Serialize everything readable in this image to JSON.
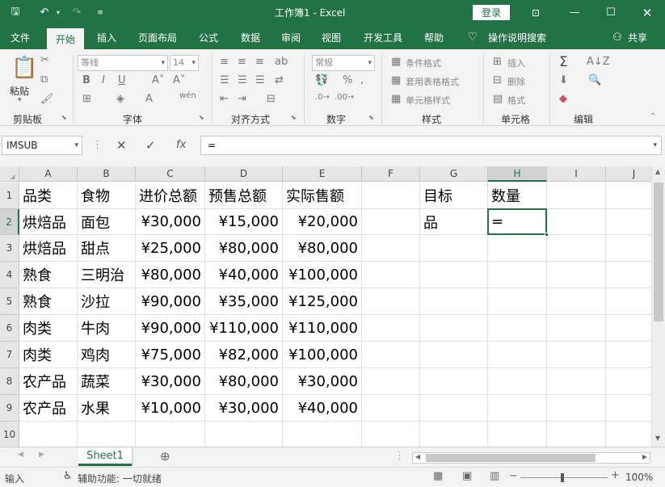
{
  "app": {
    "title": "工作簿1  -  Excel",
    "login_label": "登录"
  },
  "tabs": [
    "文件",
    "开始",
    "插入",
    "页面布局",
    "公式",
    "数据",
    "审阅",
    "视图",
    "开发工具",
    "帮助"
  ],
  "tell_me": "操作说明搜索",
  "share_label": "共享",
  "ribbon": {
    "paste_label": "粘贴",
    "font_name": "等线",
    "font_size": "14",
    "number_format": "常规",
    "conditional_format": "条件格式",
    "table_format": "套用表格格式",
    "cell_style": "单元格样式",
    "insert": "插入",
    "delete": "删除",
    "format": "格式",
    "groups": {
      "clipboard": "剪贴板",
      "font": "字体",
      "alignment": "对齐方式",
      "number": "数字",
      "styles": "样式",
      "cells": "单元格",
      "editing": "编辑"
    }
  },
  "formula_bar": {
    "name_box": "IMSUB",
    "formula": "="
  },
  "columns": [
    "A",
    "B",
    "C",
    "D",
    "E",
    "F",
    "G",
    "H",
    "I",
    "J"
  ],
  "rows": [
    "1",
    "2",
    "3",
    "4",
    "5",
    "6",
    "7",
    "8",
    "9",
    "10"
  ],
  "cells": {
    "header": [
      "品类",
      "食物",
      "进价总额",
      "预售总额",
      "实际售额"
    ],
    "data": [
      [
        "烘焙品",
        "面包",
        "¥30,000",
        "¥15,000",
        "¥20,000"
      ],
      [
        "烘焙品",
        "甜点",
        "¥25,000",
        "¥80,000",
        "¥80,000"
      ],
      [
        "熟食",
        "三明治",
        "¥80,000",
        "¥40,000",
        "¥100,000"
      ],
      [
        "熟食",
        "沙拉",
        "¥90,000",
        "¥35,000",
        "¥125,000"
      ],
      [
        "肉类",
        "牛肉",
        "¥90,000",
        "¥110,000",
        "¥110,000"
      ],
      [
        "肉类",
        "鸡肉",
        "¥75,000",
        "¥82,000",
        "¥100,000"
      ],
      [
        "农产品",
        "蔬菜",
        "¥30,000",
        "¥80,000",
        "¥30,000"
      ],
      [
        "农产品",
        "水果",
        "¥10,000",
        "¥30,000",
        "¥40,000"
      ]
    ],
    "g1": "目标",
    "h1": "数量",
    "g2": "品",
    "h2": "="
  },
  "sheet_tab": "Sheet1",
  "status": {
    "mode": "输入",
    "accessibility": "辅助功能: 一切就绪",
    "zoom": "100%"
  }
}
